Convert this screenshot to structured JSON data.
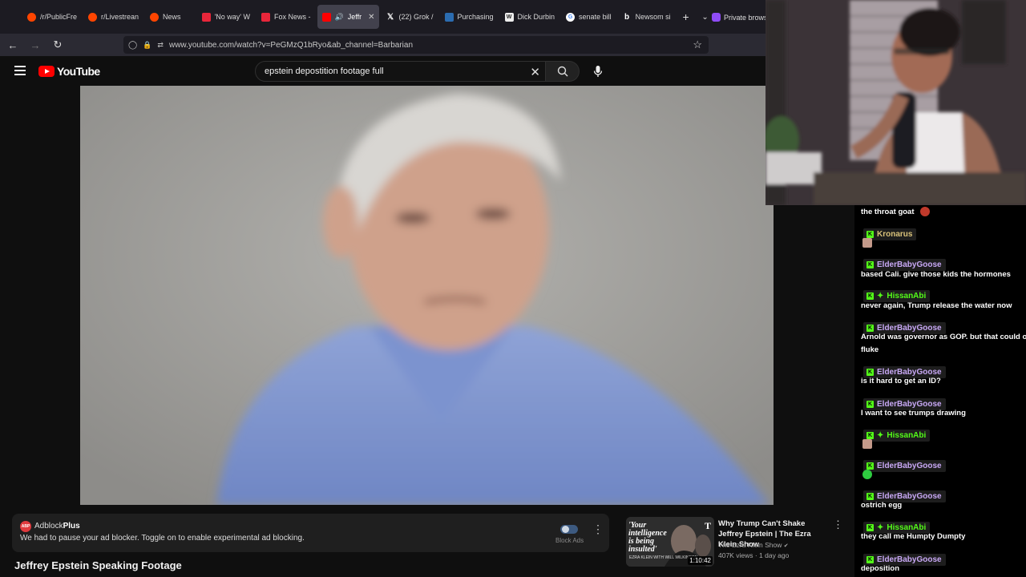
{
  "browser": {
    "tabs": [
      {
        "label": "/r/PublicFre",
        "icon": "reddit-icon"
      },
      {
        "label": "r/Livestrean",
        "icon": "reddit-icon"
      },
      {
        "label": "News",
        "icon": "reddit-icon"
      },
      {
        "label": "'No way' W",
        "icon": "fox-news-icon"
      },
      {
        "label": "Fox News -",
        "icon": "fox-news-icon"
      },
      {
        "label": "Jeffr",
        "icon": "youtube-icon",
        "active": true
      },
      {
        "label": "(22) Grok /",
        "icon": "x-icon"
      },
      {
        "label": "Purchasing",
        "icon": "site-icon"
      },
      {
        "label": "Dick Durbin",
        "icon": "wikipedia-icon"
      },
      {
        "label": "senate bill",
        "icon": "google-icon"
      },
      {
        "label": "Newsom si",
        "icon": "b-icon"
      }
    ],
    "private_label": "Private browsi",
    "url": "www.youtube.com/watch?v=PeGMzQ1bRyo&ab_channel=Barbarian"
  },
  "youtube": {
    "logo_text": "YouTube",
    "search_value": "epstein depostition footage full",
    "video_title": "Jeffrey Epstein Speaking Footage"
  },
  "adblock": {
    "brand_a": "Adblock",
    "brand_b": "Plus",
    "message": "We had to pause your ad blocker. Toggle on to enable experimental ad blocking.",
    "toggle_label": "Block Ads",
    "logo_text": "ABP"
  },
  "recommended": {
    "title": "Why Trump Can't Shake Jeffrey Epstein | The Ezra Klein Show",
    "channel": "The Ezra Klein Show",
    "meta": "407K views · 1 day ago",
    "duration": "1:10:42",
    "thumb_text": "'Your intelligence is being insulted'",
    "thumb_sub": "EZRA KLEIN WITH WILL WILKINSON",
    "thumb_brand": "T"
  },
  "chat": {
    "messages": [
      {
        "user": "",
        "text": "the throat goat",
        "emote": "fire"
      },
      {
        "user": "Kronarus",
        "text": "",
        "emote": "face"
      },
      {
        "user": "ElderBabyGoose",
        "text": "based Cali. give those kids the hormones"
      },
      {
        "user": "HissanAbi",
        "badge": "spark",
        "text": "never again, Trump release the water now"
      },
      {
        "user": "ElderBabyGoose",
        "text": "Arnold was governor as GOP. but that could o",
        "text2": "fluke"
      },
      {
        "user": "ElderBabyGoose",
        "text": "is it hard to get an ID?"
      },
      {
        "user": "ElderBabyGoose",
        "text": "I want to see trumps drawing"
      },
      {
        "user": "HissanAbi",
        "badge": "spark",
        "text": "",
        "emote": "face"
      },
      {
        "user": "ElderBabyGoose",
        "text": "",
        "emote": "green"
      },
      {
        "user": "ElderBabyGoose",
        "text": "ostrich egg"
      },
      {
        "user": "HissanAbi",
        "badge": "spark",
        "text": "they call me Humpty Dumpty"
      },
      {
        "user": "ElderBabyGoose",
        "text": "deposition"
      }
    ],
    "user_colors": {
      "Kronarus": "#d9c27a",
      "ElderBabyGoose": "#c8a8f5",
      "HissanAbi": "#53fc18"
    }
  }
}
